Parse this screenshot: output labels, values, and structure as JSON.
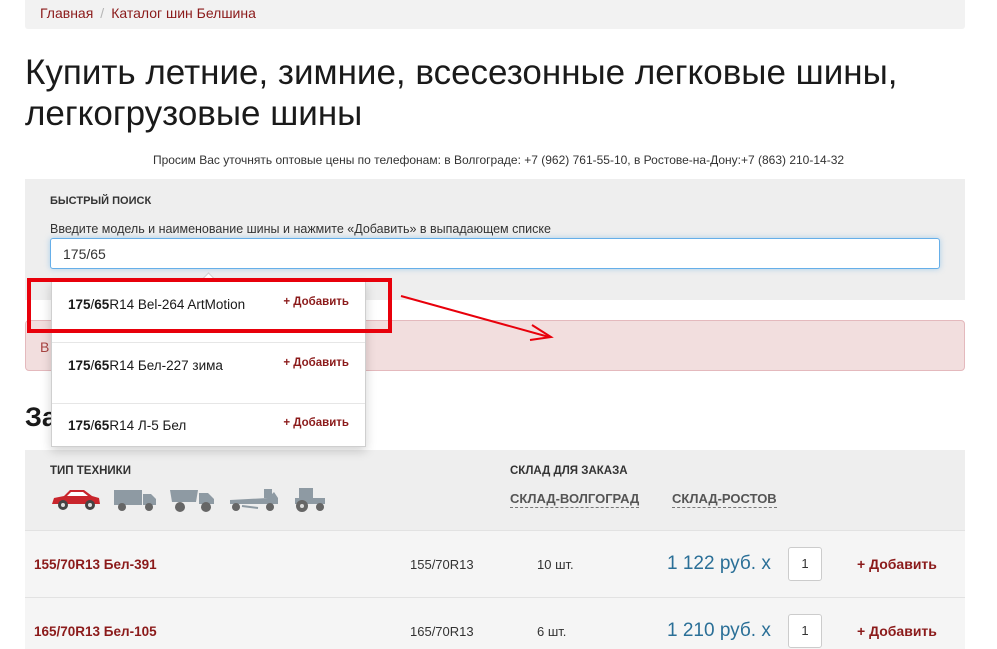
{
  "breadcrumb": {
    "home": "Главная",
    "separator": "/",
    "current": "Каталог шин Белшина"
  },
  "page_title": "Купить летние, зимние, всесезонные легковые шины, легкогрузовые шины",
  "notice": "Просим Вас уточнять оптовые цены по телефонам: в Волгограде: +7 (962) 761-55-10, в Ростове-на-Дону:+7 (863) 210-14-32",
  "quick_search": {
    "heading": "БЫСТРЫЙ ПОИСК",
    "hint": "Введите модель и наименование шины и нажмите «Добавить» в выпадающем списке",
    "value": "175/65"
  },
  "alert": {
    "visible_text": "В"
  },
  "section_title": "За",
  "dropdown": {
    "items": [
      {
        "match_a": "175",
        "slash": "/",
        "match_b": "65",
        "rest": "R14 Bel-264 ArtMotion",
        "add_label": "Добавить"
      },
      {
        "match_a": "175",
        "slash": "/",
        "match_b": "65",
        "rest": "R14 Бел-227 зима",
        "add_label": "Добавить"
      },
      {
        "match_a": "175",
        "slash": "/",
        "match_b": "65",
        "rest": "R14 Л-5 Бел",
        "add_label": "Добавить"
      }
    ]
  },
  "table": {
    "type_label": "ТИП ТЕХНИКИ",
    "warehouse_label": "СКЛАД ДЛЯ ЗАКАЗА",
    "warehouse_volgograd": "СКЛАД-ВОЛГОГРАД",
    "warehouse_rostov": "СКЛАД-РОСТОВ",
    "vehicle_icons": [
      "car-icon",
      "truck-icon",
      "dump-truck-icon",
      "grader-icon",
      "tractor-icon"
    ],
    "rows": [
      {
        "name": "155/70R13 Бел-391",
        "size": "155/70R13",
        "qty": "10 шт.",
        "price": "1 122 руб. х",
        "count": "1",
        "add_label": "Добавить"
      },
      {
        "name": "165/70R13 Бел-105",
        "size": "165/70R13",
        "qty": "6 шт.",
        "price": "1 210 руб. х",
        "count": "1",
        "add_label": "Добавить"
      }
    ]
  },
  "colors": {
    "accent": "#8b1a1a",
    "price": "#2a6f97",
    "highlight": "#e8000b",
    "car_active": "#c9252c",
    "vehicle_inactive": "#8e9aa3"
  }
}
